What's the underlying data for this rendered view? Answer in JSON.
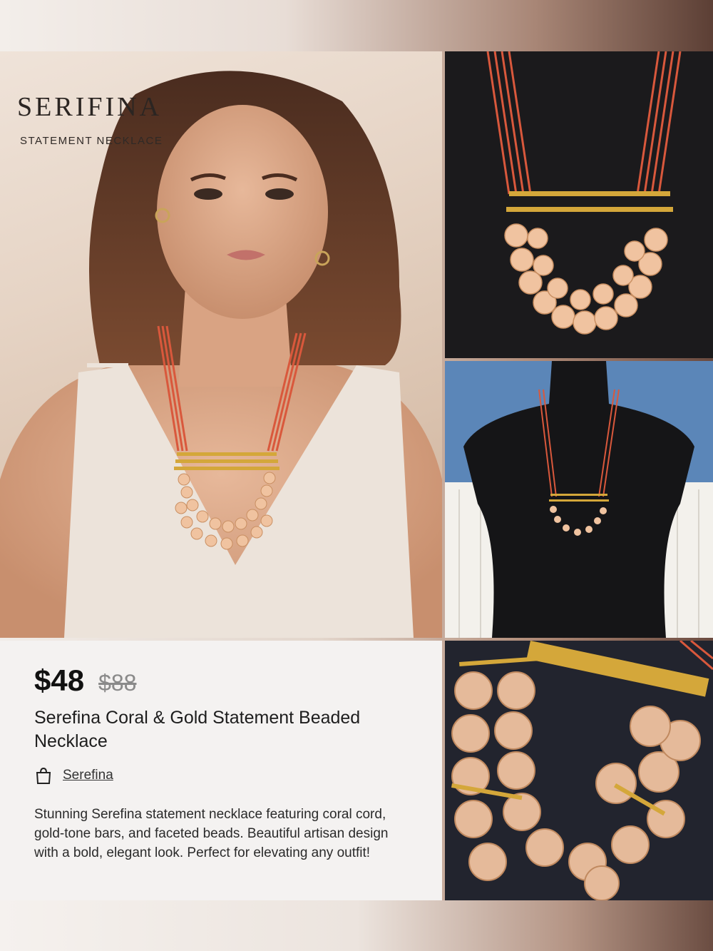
{
  "brand": {
    "name": "SERIFINA",
    "tagline": "STATEMENT NECKLACE"
  },
  "product": {
    "price": "$48",
    "original_price": "$88",
    "title": "Serefina Coral & Gold Statement Beaded Necklace",
    "seller": "Serefina",
    "description": "Stunning Serefina statement necklace featuring coral cord, gold-tone bars, and faceted beads. Beautiful artisan design with a bold, elegant look. Perfect for elevating any outfit!"
  },
  "icons": {
    "seller": "shopping-bag-icon"
  },
  "colors": {
    "coral": "#d9583c",
    "gold": "#d4a73a",
    "bead": "#f0c3a0",
    "dark_backdrop": "#1b1a1c",
    "price_text": "#111111",
    "strike_price": "#8a8a8a"
  }
}
